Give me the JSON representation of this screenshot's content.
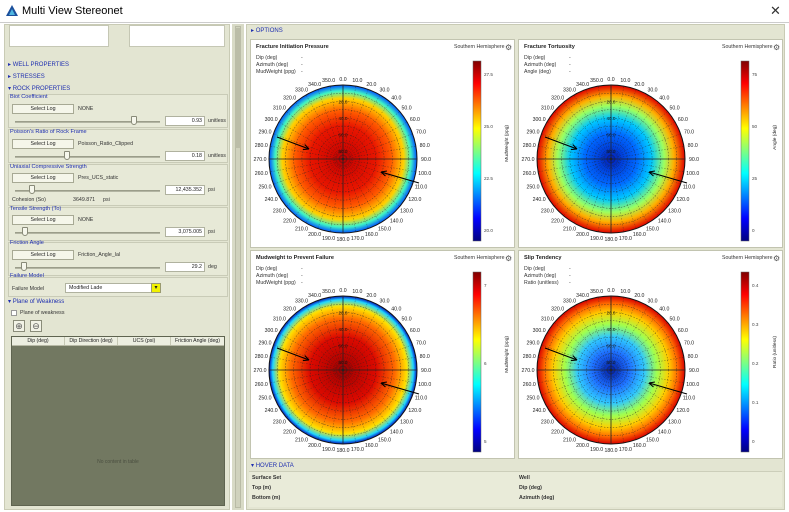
{
  "window": {
    "title": "Multi View Stereonet",
    "close_glyph": "✕"
  },
  "left": {
    "sections": {
      "well": "WELL PROPERTIES",
      "stresses": "STRESSES",
      "rock": "ROCK PROPERTIES"
    },
    "biot": {
      "label": "Biot Coefficient",
      "button": "Select Log",
      "log": "NONE",
      "value": "0.93",
      "unit": "unitless",
      "slider": 0.82
    },
    "poisson": {
      "label": "Poisson's Ratio of Rock Frame",
      "button": "Select Log",
      "log": "Poisson_Ratio_Clipped",
      "value": "0.18",
      "unit": "unitless",
      "slider": 0.36
    },
    "ucs": {
      "label": "Uniaxial Compressive Strength",
      "button": "Select Log",
      "log": "Pres_UCS_static",
      "value": "12,435.352",
      "unit": "psi",
      "slider": 0.12,
      "cohesion_label": "Cohesion (So)",
      "cohesion_value": "3649.871",
      "cohesion_unit": "psi"
    },
    "tensile": {
      "label": "Tensile Strength (To)",
      "button": "Select Log",
      "log": "NONE",
      "value": "3,075.005",
      "unit": "psi",
      "slider": 0.07
    },
    "friction": {
      "label": "Friction Angle",
      "button": "Select Log",
      "log": "Friction_Angle_lal",
      "value": "29.2",
      "unit": "deg",
      "slider": 0.06
    },
    "failure": {
      "label": "Failure Model",
      "field_label": "Failure Model",
      "value": "Modified Lade"
    },
    "weakness": {
      "section": "Plane of Weakness",
      "checkbox": "Plane of weakness",
      "add": "⊕",
      "remove": "⊖",
      "columns": [
        "Dip (deg)",
        "Dip Direction (deg)",
        "UCS (psi)",
        "Friction Angle (deg)"
      ],
      "empty": "No content in table"
    }
  },
  "right": {
    "options": "OPTIONS",
    "hover": {
      "section": "HOVER DATA",
      "surface_set": "Surface Set",
      "top": "Top (m)",
      "bottom": "Bottom (m)",
      "well": "Well",
      "dip": "Dip (deg)",
      "azimuth": "Azimuth (deg)"
    }
  },
  "compass_labels": {
    "top": "0.0",
    "bottom": "180.0",
    "left": "270.0",
    "right": "90.0",
    "ticks": [
      "10.0",
      "20.0",
      "30.0",
      "40.0",
      "50.0",
      "60.0",
      "70.0",
      "80.0",
      "100.0",
      "110.0",
      "120.0",
      "130.0",
      "140.0",
      "150.0",
      "160.0",
      "170.0",
      "190.0",
      "200.0",
      "210.0",
      "220.0",
      "230.0",
      "240.0",
      "250.0",
      "260.0",
      "280.0",
      "290.0",
      "300.0",
      "310.0",
      "320.0",
      "330.0",
      "340.0",
      "350.0"
    ]
  },
  "ring_labels": [
    "80.0",
    "60.0",
    "40.0",
    "20.0"
  ],
  "charts": [
    {
      "title": "Fracture Initiation Pressure",
      "hemisphere": "Southern Hemisphere",
      "gear_icon": "gear-icon",
      "info": [
        {
          "k": "Dip (deg)",
          "v": "-"
        },
        {
          "k": "Azimuth (deg)",
          "v": "-"
        },
        {
          "k": "MudWeight (ppg)",
          "v": "-"
        }
      ],
      "colorbar_label": "MudWeight (ppg)",
      "ticks": [
        "27.5",
        "25.0",
        "22.5",
        "20.0"
      ],
      "palette": "jet"
    },
    {
      "title": "Fracture Tortuosity",
      "hemisphere": "Southern Hemisphere",
      "gear_icon": "gear-icon",
      "info": [
        {
          "k": "Dip (deg)",
          "v": "-"
        },
        {
          "k": "Azimuth (deg)",
          "v": "-"
        },
        {
          "k": "Angle (deg)",
          "v": "-"
        }
      ],
      "colorbar_label": "Angle (deg)",
      "ticks": [
        "75",
        "50",
        "25",
        "0"
      ],
      "palette": "jet"
    },
    {
      "title": "Mudweight to Prevent Failure",
      "hemisphere": "Southern Hemisphere",
      "gear_icon": "gear-icon",
      "info": [
        {
          "k": "Dip (deg)",
          "v": "-"
        },
        {
          "k": "Azimuth (deg)",
          "v": "-"
        },
        {
          "k": "MudWeight (ppg)",
          "v": "-"
        }
      ],
      "colorbar_label": "MudWeight (ppg)",
      "ticks": [
        "7",
        "6",
        "5"
      ],
      "palette": "jet"
    },
    {
      "title": "Slip Tendency",
      "hemisphere": "Southern Hemisphere",
      "gear_icon": "gear-icon",
      "info": [
        {
          "k": "Dip (deg)",
          "v": "-"
        },
        {
          "k": "Azimuth (deg)",
          "v": "-"
        },
        {
          "k": "Ratio (unitless)",
          "v": "-"
        }
      ],
      "colorbar_label": "Ratio (unitless)",
      "ticks": [
        "0.4",
        "0.3",
        "0.2",
        "0.1",
        "0"
      ],
      "palette": "jet"
    }
  ]
}
